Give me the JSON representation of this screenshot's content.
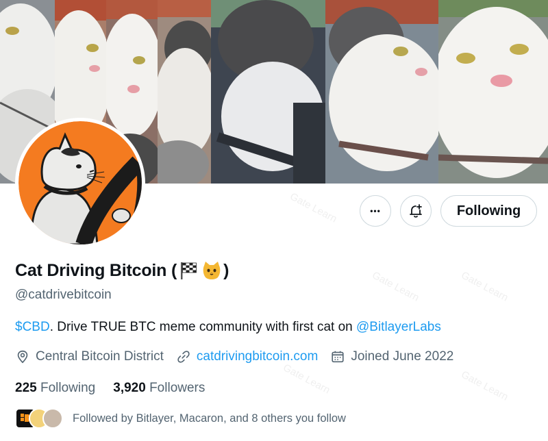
{
  "banner": {
    "panels": [
      "cat-frame-1",
      "cat-frame-2",
      "cat-frame-3",
      "cat-frame-4",
      "cat-frame-5",
      "cat-frame-6",
      "cat-frame-7"
    ]
  },
  "avatar": {
    "alt": "Cat Driving Bitcoin avatar",
    "bg_color": "#f47b20"
  },
  "actions": {
    "more_glyph": "•••",
    "following_label": "Following"
  },
  "profile": {
    "name_prefix": "Cat Driving Bitcoin (",
    "name_suffix": ")",
    "emojis": [
      "chequered-flag-icon",
      "cat-face-icon"
    ],
    "handle": "@catdrivebitcoin",
    "bio_cashtag": "$CBD",
    "bio_text": ". Drive TRUE BTC meme community with first cat on ",
    "bio_mention": "@BitlayerLabs",
    "location": "Central Bitcoin District",
    "website": "catdrivingbitcoin.com",
    "joined": "Joined June 2022"
  },
  "stats": {
    "following_count": "225",
    "following_label": "Following",
    "followers_count": "3,920",
    "followers_label": "Followers"
  },
  "followed_by": {
    "text": "Followed by Bitlayer, Macaron, and 8 others you follow"
  },
  "colors": {
    "accent": "#1d9bf0",
    "muted": "#536471",
    "text": "#0f1419"
  }
}
